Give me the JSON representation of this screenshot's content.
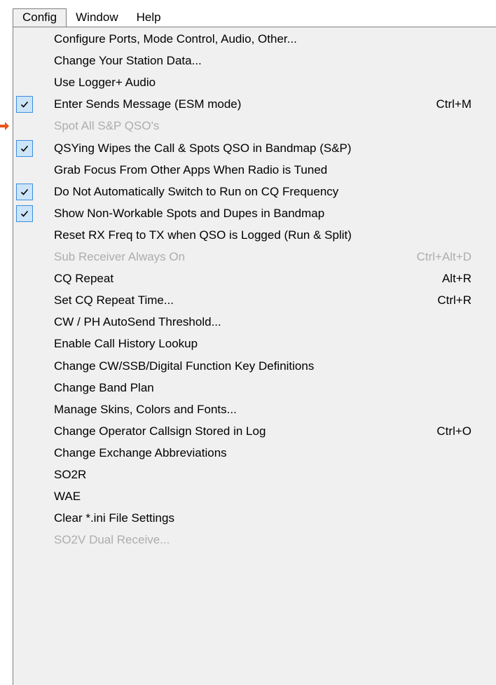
{
  "menubar": {
    "items": [
      {
        "label": "Config",
        "active": true
      },
      {
        "label": "Window",
        "active": false
      },
      {
        "label": "Help",
        "active": false
      }
    ]
  },
  "menu": {
    "items": [
      {
        "label": "Configure Ports, Mode Control, Audio, Other...",
        "shortcut": "",
        "checked": false,
        "disabled": false,
        "submenu": false
      },
      {
        "label": "Change Your Station Data...",
        "shortcut": "",
        "checked": false,
        "disabled": false,
        "submenu": false
      },
      {
        "label": "Use Logger+ Audio",
        "shortcut": "",
        "checked": false,
        "disabled": false,
        "submenu": false
      },
      {
        "label": "Enter Sends Message (ESM mode)",
        "shortcut": "Ctrl+M",
        "checked": true,
        "disabled": false,
        "submenu": false
      },
      {
        "label": "Spot All S&P QSO's",
        "shortcut": "",
        "checked": false,
        "disabled": true,
        "submenu": false
      },
      {
        "label": "QSYing Wipes the Call & Spots QSO in Bandmap (S&P)",
        "shortcut": "",
        "checked": true,
        "disabled": false,
        "submenu": false
      },
      {
        "label": "Grab Focus From Other Apps When Radio is Tuned",
        "shortcut": "",
        "checked": false,
        "disabled": false,
        "submenu": false
      },
      {
        "label": "Do Not Automatically Switch to Run on CQ Frequency",
        "shortcut": "",
        "checked": true,
        "disabled": false,
        "submenu": false
      },
      {
        "label": "Show Non-Workable Spots and Dupes in Bandmap",
        "shortcut": "",
        "checked": true,
        "disabled": false,
        "submenu": false
      },
      {
        "label": "Reset RX Freq to TX when QSO is Logged (Run & Split)",
        "shortcut": "",
        "checked": false,
        "disabled": false,
        "submenu": false
      },
      {
        "label": "Sub Receiver Always On",
        "shortcut": "Ctrl+Alt+D",
        "checked": false,
        "disabled": true,
        "submenu": false
      },
      {
        "label": "CQ Repeat",
        "shortcut": "Alt+R",
        "checked": false,
        "disabled": false,
        "submenu": false
      },
      {
        "label": "Set CQ Repeat Time...",
        "shortcut": "Ctrl+R",
        "checked": false,
        "disabled": false,
        "submenu": false
      },
      {
        "label": "CW / PH AutoSend Threshold...",
        "shortcut": "",
        "checked": false,
        "disabled": false,
        "submenu": false
      },
      {
        "label": "Enable Call History Lookup",
        "shortcut": "",
        "checked": false,
        "disabled": false,
        "submenu": false
      },
      {
        "label": "Change CW/SSB/Digital Function Key Definitions",
        "shortcut": "",
        "checked": false,
        "disabled": false,
        "submenu": true
      },
      {
        "label": "Change Band Plan",
        "shortcut": "",
        "checked": false,
        "disabled": false,
        "submenu": true
      },
      {
        "label": "Manage Skins, Colors and Fonts...",
        "shortcut": "",
        "checked": false,
        "disabled": false,
        "submenu": false
      },
      {
        "label": "Change Operator Callsign Stored in Log",
        "shortcut": "Ctrl+O",
        "checked": false,
        "disabled": false,
        "submenu": false
      },
      {
        "label": "Change Exchange Abbreviations",
        "shortcut": "",
        "checked": false,
        "disabled": false,
        "submenu": true
      },
      {
        "label": "SO2R",
        "shortcut": "",
        "checked": false,
        "disabled": false,
        "submenu": true
      },
      {
        "label": "WAE",
        "shortcut": "",
        "checked": false,
        "disabled": false,
        "submenu": true
      },
      {
        "label": "Clear *.ini File Settings",
        "shortcut": "",
        "checked": false,
        "disabled": false,
        "submenu": false
      },
      {
        "label": "SO2V Dual Receive...",
        "shortcut": "",
        "checked": false,
        "disabled": true,
        "submenu": true
      }
    ]
  },
  "colors": {
    "menu_bg": "#f0f0f0",
    "disabled_text": "#adadad",
    "check_border": "#3d8de0",
    "check_fill": "#cce4f7",
    "pointer_arrow": "#e8551e"
  },
  "icons": {
    "check": "check-icon",
    "submenu": "submenu-arrow-icon",
    "pointer": "pointer-arrow-icon"
  }
}
